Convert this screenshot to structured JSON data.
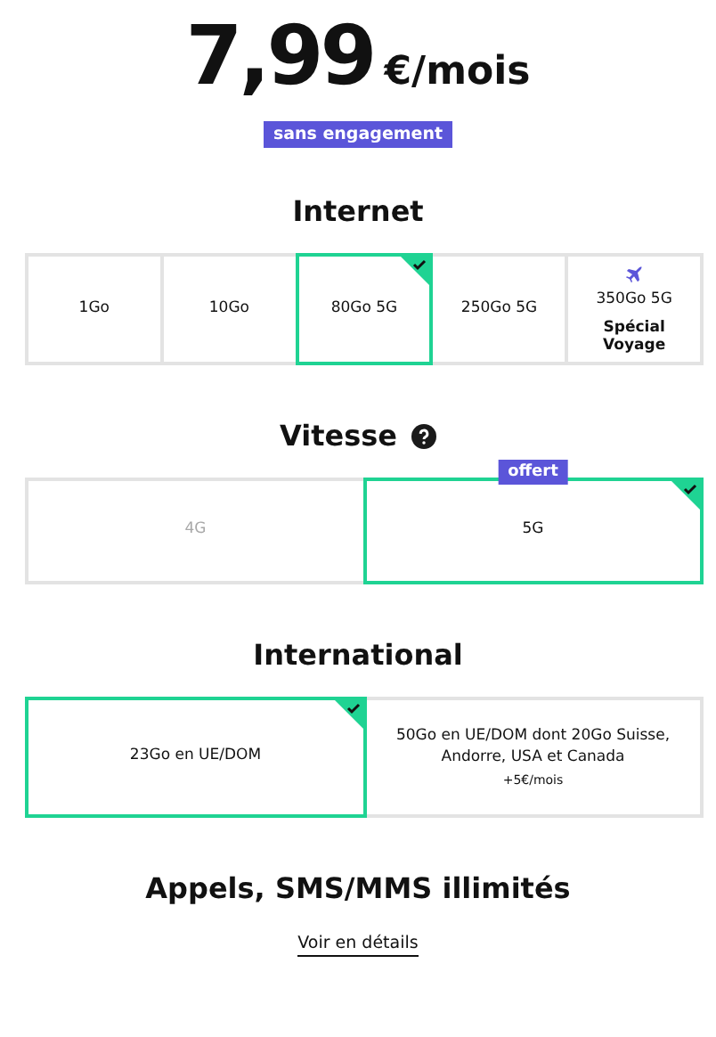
{
  "price": {
    "amount": "7,99",
    "unit": "€/mois",
    "badge": "sans engagement"
  },
  "sections": [
    {
      "title": "Internet",
      "options": [
        {
          "kind": "plain",
          "label": "1Go",
          "selected": false
        },
        {
          "kind": "plain",
          "label": "10Go",
          "selected": false
        },
        {
          "kind": "plain",
          "label": "80Go 5G",
          "selected": true
        },
        {
          "kind": "plain",
          "label": "250Go 5G",
          "selected": false
        },
        {
          "kind": "travel",
          "label": "350Go 5G",
          "sublabel": "Spécial Voyage",
          "selected": false
        }
      ]
    },
    {
      "title": "Vitesse",
      "help": true,
      "options": [
        {
          "label": "4G",
          "selected": false,
          "disabled": true
        },
        {
          "label": "5G",
          "selected": true,
          "disabled": false,
          "badge": "offert"
        }
      ]
    },
    {
      "title": "International",
      "options": [
        {
          "label": "23Go en UE/DOM",
          "selected": true
        },
        {
          "label": "50Go en UE/DOM dont 20Go Suisse, Andorre, USA et Canada",
          "note": "+5€/mois",
          "selected": false
        }
      ]
    }
  ],
  "footer": {
    "title": "Appels, SMS/MMS illimités",
    "link": "Voir en détails"
  }
}
